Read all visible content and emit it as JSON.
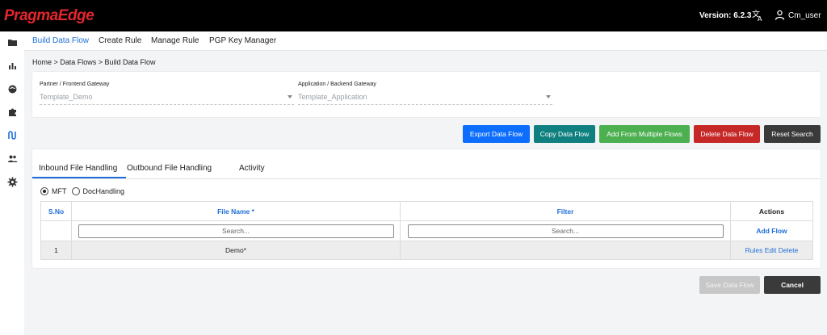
{
  "header": {
    "brand": "PragmaEdge",
    "version": "Version: 6.2.3",
    "username": "Cm_user"
  },
  "sidebar": {
    "icons": [
      "folder-icon",
      "bar-chart-icon",
      "globe-icon",
      "puzzle-icon",
      "flow-icon",
      "users-icon",
      "gear-icon"
    ]
  },
  "nav": {
    "items": [
      "Build Data Flow",
      "Create Rule",
      "Manage Rule",
      "PGP Key Manager"
    ]
  },
  "breadcrumb": "Home > Data Flows > Build Data Flow",
  "selectors": {
    "partner": {
      "label": "Partner / Frontend Gateway",
      "value": "Template_Demo"
    },
    "application": {
      "label": "Application / Backend Gateway",
      "value": "Template_Application"
    }
  },
  "actions": {
    "export": "Export Data Flow",
    "copy": "Copy Data Flow",
    "add_multiple": "Add From Multiple Flows",
    "delete": "Delete Data Flow",
    "reset": "Reset Search"
  },
  "tabs": [
    "Inbound File Handling",
    "Outbound File Handling",
    "Activity"
  ],
  "radios": {
    "mft": "MFT",
    "doc": "DocHandling"
  },
  "table": {
    "headers": {
      "sno": "S.No",
      "file_name": "File Name *",
      "filter": "Filter",
      "actions": "Actions"
    },
    "search_placeholder": "Search...",
    "add_flow": "Add Flow",
    "rows": [
      {
        "sno": "1",
        "file_name": "Demo*",
        "filter": "",
        "rules": "Rules",
        "edit": "Edit",
        "delete": "Delete"
      }
    ]
  },
  "footer": {
    "save": "Save Data Flow",
    "cancel": "Cancel"
  },
  "colors": {
    "accent": "#1e6fd9",
    "export": "#0d6efd",
    "copy": "#0f7f7f",
    "add": "#4caf50",
    "delete": "#c62828",
    "reset": "#3a3a3a",
    "brand": "#e3262d"
  }
}
